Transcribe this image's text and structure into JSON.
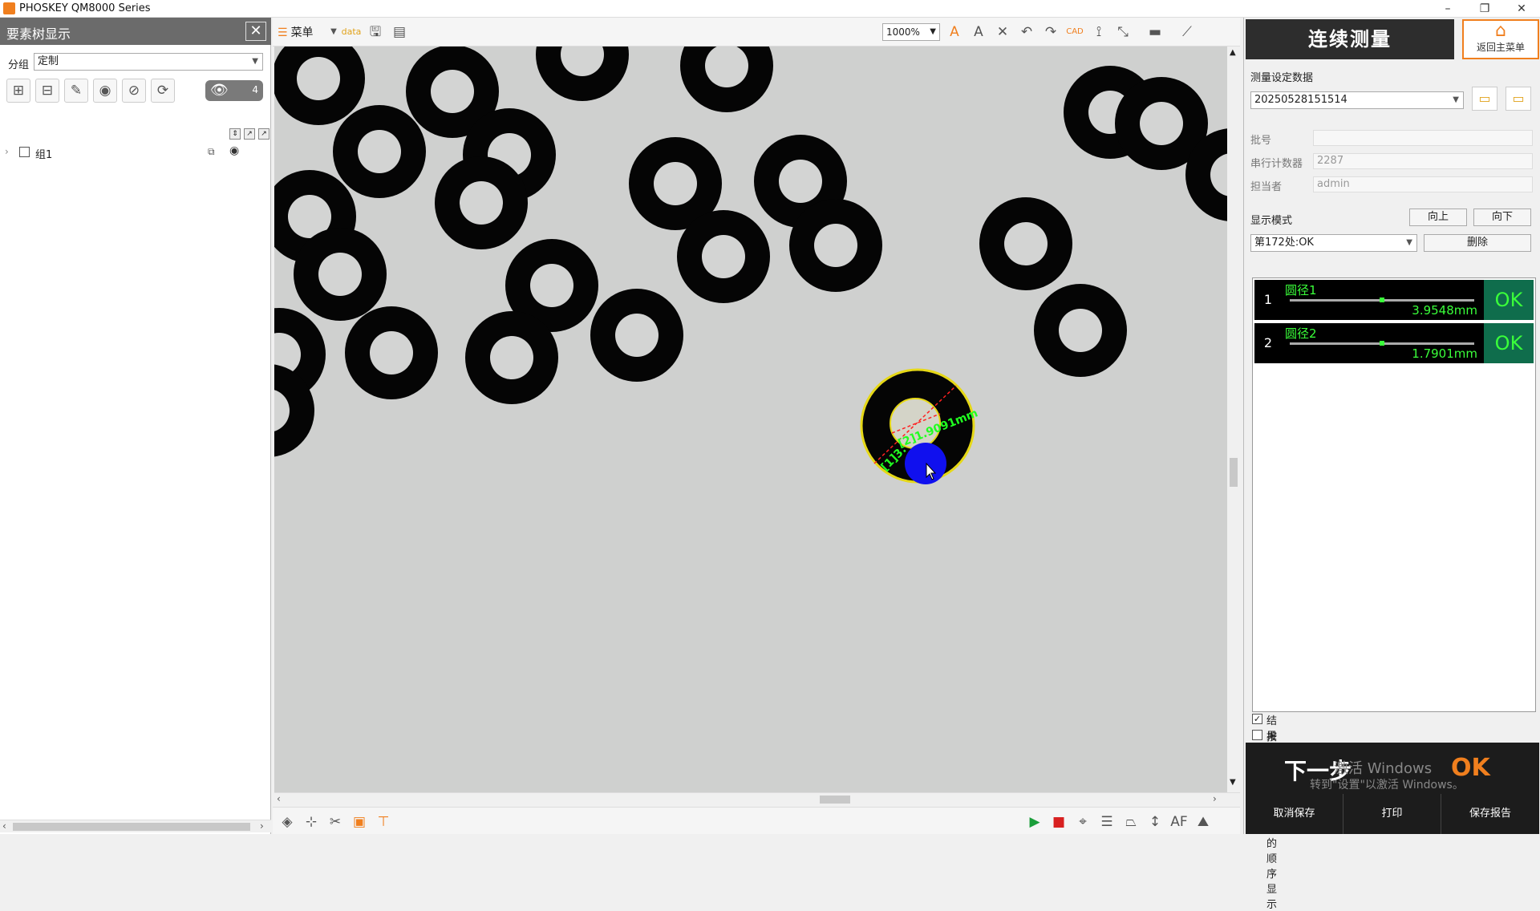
{
  "window": {
    "title": "PHOSKEY QM8000 Series",
    "minimize": "–",
    "restore": "❐",
    "close": "✕"
  },
  "left_panel": {
    "title": "要素树显示",
    "close": "✕",
    "group_label": "分组",
    "group_value": "定制",
    "eye_count": "4",
    "tree": [
      {
        "label": "组1"
      }
    ]
  },
  "toolbar": {
    "menu_label": "菜单",
    "zoom": "1000%",
    "data_icon_label": "data",
    "cad_label": "CAD"
  },
  "canvas": {
    "dim_label_1": "[2]1.9091mm",
    "dim_label_2": "[1]3."
  },
  "right_panel": {
    "mode_title": "连续测量",
    "home_label": "返回主菜单",
    "settings_label": "测量设定数据",
    "settings_value": "20250528151514",
    "fields": [
      {
        "label": "批号",
        "value": ""
      },
      {
        "label": "串行计数器",
        "value": "2287"
      },
      {
        "label": "担当者",
        "value": "admin"
      }
    ],
    "display_mode_label": "显示模式",
    "up_label": "向上",
    "down_label": "向下",
    "position_value": "第172处:OK",
    "delete_label": "删除",
    "results": [
      {
        "index": "1",
        "name": "圆径1",
        "value": "3.9548mm",
        "status": "OK",
        "level": 0.5
      },
      {
        "index": "2",
        "name": "圆径2",
        "value": "1.7901mm",
        "status": "OK",
        "level": 0.5
      }
    ],
    "check_enlarge": "结果放大显示",
    "check_order": "按误差从大到小的顺序显示",
    "next_label": "下一步",
    "overall_status": "OK",
    "watermark_1": "激活 Windows",
    "watermark_2": "转到\"设置\"以激活 Windows。",
    "cancel_save": "取消保存",
    "print": "打印",
    "save_report": "保存报告"
  }
}
